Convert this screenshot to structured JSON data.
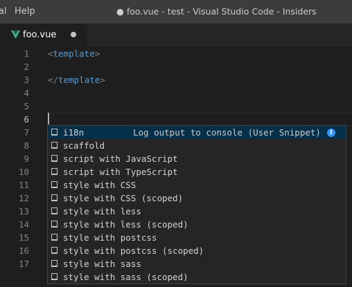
{
  "titlebar": {
    "menu_items": [
      "al",
      "Help"
    ],
    "window_title": "● foo.vue - test - Visual Studio Code - Insiders"
  },
  "tabs": [
    {
      "label": "foo.vue",
      "icon": "vue-icon",
      "dirty": true
    }
  ],
  "editor": {
    "line_numbers": [
      "1",
      "2",
      "3",
      "4",
      "5",
      "6",
      "7",
      "8",
      "9",
      "10",
      "11",
      "12",
      "13",
      "14",
      "15",
      "16",
      "17"
    ],
    "active_line": "6",
    "code_lines": {
      "line1": {
        "open": "<",
        "tag": "template",
        "close": ">"
      },
      "line3": {
        "open": "</",
        "tag": "template",
        "close": ">"
      }
    }
  },
  "suggest_widget": {
    "items": [
      {
        "label": "i18n",
        "icon": "snippet-icon",
        "detail": "Log output to console (User Snippet)",
        "selected": true
      },
      {
        "label": "scaffold",
        "icon": "snippet-icon"
      },
      {
        "label": "script with JavaScript",
        "icon": "snippet-icon"
      },
      {
        "label": "script with TypeScript",
        "icon": "snippet-icon"
      },
      {
        "label": "style with CSS",
        "icon": "snippet-icon"
      },
      {
        "label": "style with CSS (scoped)",
        "icon": "snippet-icon"
      },
      {
        "label": "style with less",
        "icon": "snippet-icon"
      },
      {
        "label": "style with less (scoped)",
        "icon": "snippet-icon"
      },
      {
        "label": "style with postcss",
        "icon": "snippet-icon"
      },
      {
        "label": "style with postcss (scoped)",
        "icon": "snippet-icon"
      },
      {
        "label": "style with sass",
        "icon": "snippet-icon"
      },
      {
        "label": "style with sass (scoped)",
        "icon": "snippet-icon"
      }
    ],
    "info_glyph": "i"
  },
  "colors": {
    "editor_background": "#1e1e1e",
    "titlebar_background": "#3c3c3c",
    "tag_color": "#569cd6",
    "bracket_color": "#808080",
    "selected_row": "#062f4a",
    "vue_green": "#41b883"
  }
}
